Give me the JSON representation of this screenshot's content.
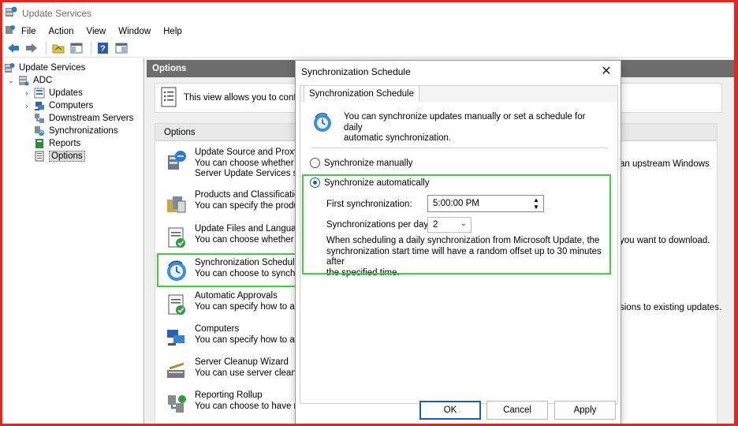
{
  "window": {
    "title": "Update Services"
  },
  "menu": [
    "File",
    "Action",
    "View",
    "Window",
    "Help"
  ],
  "toolbar": [
    {
      "name": "back-icon"
    },
    {
      "name": "forward-icon"
    },
    {
      "name": "folder-icon"
    },
    {
      "name": "show-hide-tree-icon"
    },
    {
      "name": "help-icon"
    },
    {
      "name": "properties-icon"
    }
  ],
  "tree": {
    "root": "Update Services",
    "server": "ADC",
    "items": [
      "Updates",
      "Computers",
      "Downstream Servers",
      "Synchronizations",
      "Reports",
      "Options"
    ],
    "selected": "Options"
  },
  "main": {
    "header": "Options",
    "info": "This view allows you to configu",
    "options_header": "Options",
    "options": [
      {
        "title": "Update Source and Proxy S",
        "line1": "You can choose whether th",
        "line2": "Server Update Services serv",
        "extra": "an upstream Windows"
      },
      {
        "title": "Products and Classification",
        "line1": "You can specify the produc",
        "line2": "",
        "extra": ""
      },
      {
        "title": "Update Files and Language",
        "line1": "You can choose whether to",
        "line2": "",
        "extra": "you want to download."
      },
      {
        "title": "Synchronization Schedule",
        "line1": "You can choose to synchro",
        "line2": "",
        "extra": ""
      },
      {
        "title": "Automatic Approvals",
        "line1": "You can specify how to au",
        "line2": "",
        "extra": "sions to existing updates."
      },
      {
        "title": "Computers",
        "line1": "You can specify how to ass",
        "line2": "",
        "extra": ""
      },
      {
        "title": "Server Cleanup Wizard",
        "line1": "You can use server cleanup",
        "line2": "",
        "extra": ""
      },
      {
        "title": "Reporting Rollup",
        "line1": "You can choose to have rep",
        "line2": "",
        "extra": ""
      }
    ]
  },
  "dialog": {
    "title": "Synchronization Schedule",
    "tab": "Synchronization Schedule",
    "intro_line1": "You can synchronize updates manually or set a schedule for daily",
    "intro_line2": "automatic synchronization.",
    "radio_manual": "Synchronize manually",
    "radio_auto": "Synchronize automatically",
    "selected_radio": "auto",
    "first_sync_label": "First synchronization:",
    "first_sync_value": "5:00:00 PM",
    "per_day_label": "Synchronizations per day:",
    "per_day_value": "2",
    "note_line1": "When scheduling a daily synchronization from Microsoft Update, the",
    "note_line2": "synchronization start time will have a random offset up to 30 minutes after",
    "note_line3": "the specified time.",
    "buttons": {
      "ok": "OK",
      "cancel": "Cancel",
      "apply": "Apply"
    }
  },
  "colors": {
    "highlight": "#3cd23c",
    "frame": "#e8241d",
    "header": "#6d6d6d",
    "accent": "#1a5fb4"
  }
}
